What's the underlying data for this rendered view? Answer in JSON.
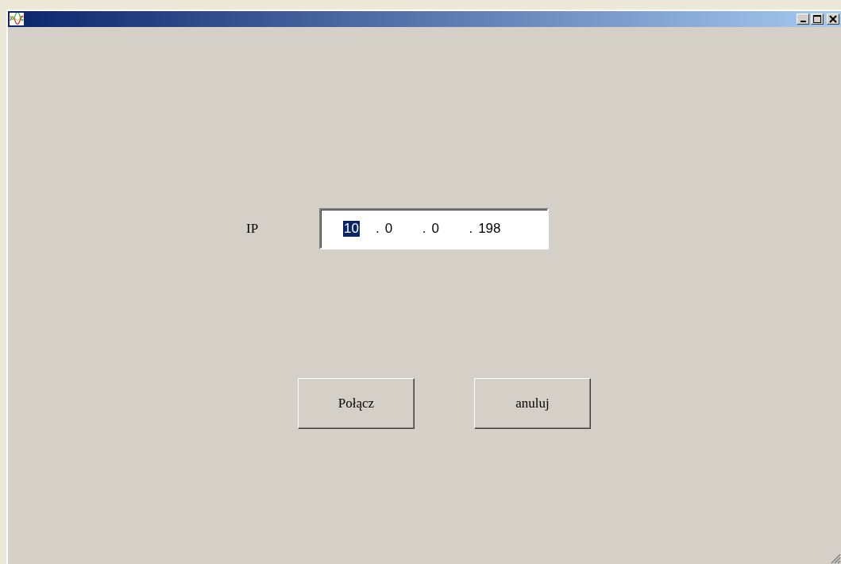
{
  "ip": {
    "label": "IP",
    "octets": [
      {
        "value": "10",
        "selected": true
      },
      {
        "value": "0",
        "selected": false
      },
      {
        "value": "0",
        "selected": false
      },
      {
        "value": "198",
        "selected": false
      }
    ],
    "separators": [
      ".",
      ".",
      "."
    ]
  },
  "buttons": [
    "Połącz",
    "anuluj"
  ]
}
